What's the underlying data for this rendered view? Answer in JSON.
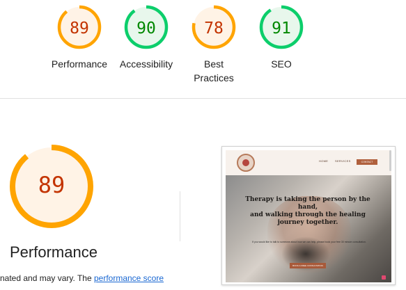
{
  "colors": {
    "average_fg": "#c33300",
    "average_fill": "#fff3e6",
    "average_ring": "#ffa400",
    "pass_fg": "#008800",
    "pass_fill": "#e8f7ec",
    "pass_ring": "#0cce6b",
    "link": "#1967d2"
  },
  "summary": {
    "gauges": [
      {
        "score": "89",
        "value": 0.89,
        "label": "Performance",
        "rating": "average"
      },
      {
        "score": "90",
        "value": 0.9,
        "label": "Accessibility",
        "rating": "pass"
      },
      {
        "score": "78",
        "value": 0.78,
        "label_line1": "Best",
        "label_line2": "Practices",
        "rating": "average"
      },
      {
        "score": "91",
        "value": 0.91,
        "label": "SEO",
        "rating": "pass"
      }
    ]
  },
  "performance": {
    "score": "89",
    "value": 0.89,
    "title": "Performance",
    "desc_prefix": "nated and may vary. The ",
    "desc_link": "performance score"
  },
  "screenshot": {
    "nav_home": "HOME",
    "nav_services": "SERVICES",
    "nav_contact": "CONTACT",
    "hero_line1": "Therapy is taking the person by the hand,",
    "hero_line2": "and walking through the healing",
    "hero_line3": "journey together.",
    "hero_sub": "If you would like to talk to someone about how we can help, please book your free 30 minute consultation.",
    "hero_button": "BOOK A FREE CONSULTATION"
  }
}
